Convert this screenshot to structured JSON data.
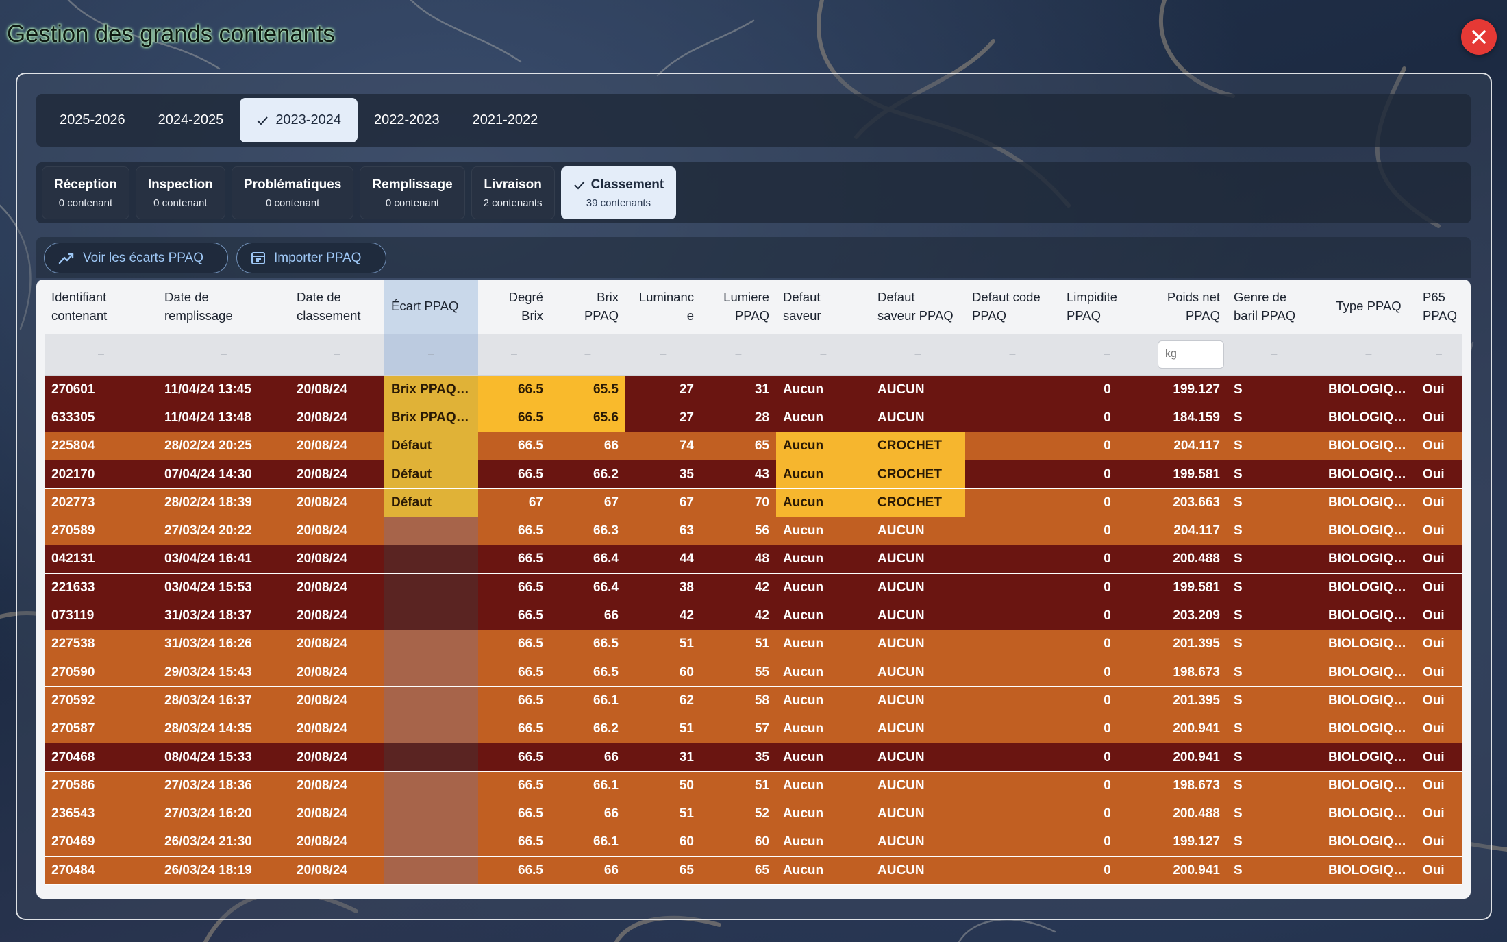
{
  "app": {
    "title": "Gestion des grands contenants"
  },
  "years": [
    {
      "label": "2025-2026",
      "active": false
    },
    {
      "label": "2024-2025",
      "active": false
    },
    {
      "label": "2023-2024",
      "active": true
    },
    {
      "label": "2022-2023",
      "active": false
    },
    {
      "label": "2021-2022",
      "active": false
    }
  ],
  "stages": [
    {
      "label": "Réception",
      "count": "0 contenant",
      "active": false
    },
    {
      "label": "Inspection",
      "count": "0 contenant",
      "active": false
    },
    {
      "label": "Problématiques",
      "count": "0 contenant",
      "active": false
    },
    {
      "label": "Remplissage",
      "count": "0 contenant",
      "active": false
    },
    {
      "label": "Livraison",
      "count": "2 contenants",
      "active": false
    },
    {
      "label": "Classement",
      "count": "39 contenants",
      "active": true
    }
  ],
  "actions": {
    "voir_ecarts": "Voir les écarts PPAQ",
    "importer": "Importer PPAQ"
  },
  "table": {
    "headers": {
      "id": [
        "Identifiant",
        "contenant"
      ],
      "date_remplissage": [
        "Date de",
        "remplissage"
      ],
      "date_classement": [
        "Date de",
        "classement"
      ],
      "ecart": [
        "Écart PPAQ"
      ],
      "degre_brix": [
        "Degré",
        "Brix"
      ],
      "brix_ppaq": [
        "Brix",
        "PPAQ"
      ],
      "luminance": [
        "Luminanc",
        "e"
      ],
      "lumiere_ppaq": [
        "Lumiere",
        "PPAQ"
      ],
      "defaut_saveur": [
        "Defaut",
        "saveur"
      ],
      "defaut_saveur_ppaq": [
        "Defaut",
        "saveur PPAQ"
      ],
      "defaut_code_ppaq": [
        "Defaut code",
        "PPAQ"
      ],
      "limpidite_ppaq": [
        "Limpidite",
        "PPAQ"
      ],
      "poids_net_ppaq": [
        "Poids net",
        "PPAQ"
      ],
      "genre_baril": [
        "Genre de",
        "baril PPAQ"
      ],
      "type_ppaq": [
        "Type PPAQ"
      ],
      "p65_ppaq": [
        "P65",
        "PPAQ"
      ]
    },
    "filter_dash": "–",
    "kg_placeholder": "kg",
    "colors": {
      "orange": "#c15f22",
      "dark_red": "#6a1511",
      "yellow": "#f9ba2c"
    },
    "rows": [
      {
        "tone": "dark",
        "id": "270601",
        "date_remplissage": "11/04/24 13:45",
        "date_classement": "20/08/24",
        "ecart": "Brix PPAQ différent",
        "ecart_flag": true,
        "degre_brix": "66.5",
        "brix_ppaq": "65.5",
        "hl_brix": true,
        "luminance": "27",
        "lumiere_ppaq": "31",
        "defaut_saveur": "Aucun",
        "defaut_saveur_ppaq": "AUCUN",
        "hl_saveur": false,
        "defaut_code_ppaq": "",
        "limpidite_ppaq": "0",
        "poids_net_ppaq": "199.127",
        "genre_baril": "S",
        "type_ppaq": "BIOLOGIQUE",
        "p65_ppaq": "Oui"
      },
      {
        "tone": "dark",
        "id": "633305",
        "date_remplissage": "11/04/24 13:48",
        "date_classement": "20/08/24",
        "ecart": "Brix PPAQ différent",
        "ecart_flag": true,
        "degre_brix": "66.5",
        "brix_ppaq": "65.6",
        "hl_brix": true,
        "luminance": "27",
        "lumiere_ppaq": "28",
        "defaut_saveur": "Aucun",
        "defaut_saveur_ppaq": "AUCUN",
        "hl_saveur": false,
        "defaut_code_ppaq": "",
        "limpidite_ppaq": "0",
        "poids_net_ppaq": "184.159",
        "genre_baril": "S",
        "type_ppaq": "BIOLOGIQUE",
        "p65_ppaq": "Oui"
      },
      {
        "tone": "orange",
        "id": "225804",
        "date_remplissage": "28/02/24 20:25",
        "date_classement": "20/08/24",
        "ecart": "Défaut",
        "ecart_flag": true,
        "degre_brix": "66.5",
        "brix_ppaq": "66",
        "hl_brix": false,
        "luminance": "74",
        "lumiere_ppaq": "65",
        "defaut_saveur": "Aucun",
        "defaut_saveur_ppaq": "CROCHET",
        "hl_saveur": true,
        "defaut_code_ppaq": "",
        "limpidite_ppaq": "0",
        "poids_net_ppaq": "204.117",
        "genre_baril": "S",
        "type_ppaq": "BIOLOGIQUE",
        "p65_ppaq": "Oui"
      },
      {
        "tone": "dark",
        "id": "202170",
        "date_remplissage": "07/04/24 14:30",
        "date_classement": "20/08/24",
        "ecart": "Défaut",
        "ecart_flag": true,
        "degre_brix": "66.5",
        "brix_ppaq": "66.2",
        "hl_brix": false,
        "luminance": "35",
        "lumiere_ppaq": "43",
        "defaut_saveur": "Aucun",
        "defaut_saveur_ppaq": "CROCHET",
        "hl_saveur": true,
        "defaut_code_ppaq": "",
        "limpidite_ppaq": "0",
        "poids_net_ppaq": "199.581",
        "genre_baril": "S",
        "type_ppaq": "BIOLOGIQUE",
        "p65_ppaq": "Oui"
      },
      {
        "tone": "orange",
        "id": "202773",
        "date_remplissage": "28/02/24 18:39",
        "date_classement": "20/08/24",
        "ecart": "Défaut",
        "ecart_flag": true,
        "degre_brix": "67",
        "brix_ppaq": "67",
        "hl_brix": false,
        "luminance": "67",
        "lumiere_ppaq": "70",
        "defaut_saveur": "Aucun",
        "defaut_saveur_ppaq": "CROCHET",
        "hl_saveur": true,
        "defaut_code_ppaq": "",
        "limpidite_ppaq": "0",
        "poids_net_ppaq": "203.663",
        "genre_baril": "S",
        "type_ppaq": "BIOLOGIQUE",
        "p65_ppaq": "Oui"
      },
      {
        "tone": "orange",
        "id": "270589",
        "date_remplissage": "27/03/24 20:22",
        "date_classement": "20/08/24",
        "ecart": "",
        "ecart_flag": false,
        "degre_brix": "66.5",
        "brix_ppaq": "66.3",
        "hl_brix": false,
        "luminance": "63",
        "lumiere_ppaq": "56",
        "defaut_saveur": "Aucun",
        "defaut_saveur_ppaq": "AUCUN",
        "hl_saveur": false,
        "defaut_code_ppaq": "",
        "limpidite_ppaq": "0",
        "poids_net_ppaq": "204.117",
        "genre_baril": "S",
        "type_ppaq": "BIOLOGIQUE",
        "p65_ppaq": "Oui"
      },
      {
        "tone": "dark",
        "id": "042131",
        "date_remplissage": "03/04/24 16:41",
        "date_classement": "20/08/24",
        "ecart": "",
        "ecart_flag": false,
        "degre_brix": "66.5",
        "brix_ppaq": "66.4",
        "hl_brix": false,
        "luminance": "44",
        "lumiere_ppaq": "48",
        "defaut_saveur": "Aucun",
        "defaut_saveur_ppaq": "AUCUN",
        "hl_saveur": false,
        "defaut_code_ppaq": "",
        "limpidite_ppaq": "0",
        "poids_net_ppaq": "200.488",
        "genre_baril": "S",
        "type_ppaq": "BIOLOGIQUE",
        "p65_ppaq": "Oui"
      },
      {
        "tone": "dark",
        "id": "221633",
        "date_remplissage": "03/04/24 15:53",
        "date_classement": "20/08/24",
        "ecart": "",
        "ecart_flag": false,
        "degre_brix": "66.5",
        "brix_ppaq": "66.4",
        "hl_brix": false,
        "luminance": "38",
        "lumiere_ppaq": "42",
        "defaut_saveur": "Aucun",
        "defaut_saveur_ppaq": "AUCUN",
        "hl_saveur": false,
        "defaut_code_ppaq": "",
        "limpidite_ppaq": "0",
        "poids_net_ppaq": "199.581",
        "genre_baril": "S",
        "type_ppaq": "BIOLOGIQUE",
        "p65_ppaq": "Oui"
      },
      {
        "tone": "dark",
        "id": "073119",
        "date_remplissage": "31/03/24 18:37",
        "date_classement": "20/08/24",
        "ecart": "",
        "ecart_flag": false,
        "degre_brix": "66.5",
        "brix_ppaq": "66",
        "hl_brix": false,
        "luminance": "42",
        "lumiere_ppaq": "42",
        "defaut_saveur": "Aucun",
        "defaut_saveur_ppaq": "AUCUN",
        "hl_saveur": false,
        "defaut_code_ppaq": "",
        "limpidite_ppaq": "0",
        "poids_net_ppaq": "203.209",
        "genre_baril": "S",
        "type_ppaq": "BIOLOGIQUE",
        "p65_ppaq": "Oui"
      },
      {
        "tone": "orange",
        "id": "227538",
        "date_remplissage": "31/03/24 16:26",
        "date_classement": "20/08/24",
        "ecart": "",
        "ecart_flag": false,
        "degre_brix": "66.5",
        "brix_ppaq": "66.5",
        "hl_brix": false,
        "luminance": "51",
        "lumiere_ppaq": "51",
        "defaut_saveur": "Aucun",
        "defaut_saveur_ppaq": "AUCUN",
        "hl_saveur": false,
        "defaut_code_ppaq": "",
        "limpidite_ppaq": "0",
        "poids_net_ppaq": "201.395",
        "genre_baril": "S",
        "type_ppaq": "BIOLOGIQUE",
        "p65_ppaq": "Oui"
      },
      {
        "tone": "orange",
        "id": "270590",
        "date_remplissage": "29/03/24 15:43",
        "date_classement": "20/08/24",
        "ecart": "",
        "ecart_flag": false,
        "degre_brix": "66.5",
        "brix_ppaq": "66.5",
        "hl_brix": false,
        "luminance": "60",
        "lumiere_ppaq": "55",
        "defaut_saveur": "Aucun",
        "defaut_saveur_ppaq": "AUCUN",
        "hl_saveur": false,
        "defaut_code_ppaq": "",
        "limpidite_ppaq": "0",
        "poids_net_ppaq": "198.673",
        "genre_baril": "S",
        "type_ppaq": "BIOLOGIQUE",
        "p65_ppaq": "Oui"
      },
      {
        "tone": "orange",
        "id": "270592",
        "date_remplissage": "28/03/24 16:37",
        "date_classement": "20/08/24",
        "ecart": "",
        "ecart_flag": false,
        "degre_brix": "66.5",
        "brix_ppaq": "66.1",
        "hl_brix": false,
        "luminance": "62",
        "lumiere_ppaq": "58",
        "defaut_saveur": "Aucun",
        "defaut_saveur_ppaq": "AUCUN",
        "hl_saveur": false,
        "defaut_code_ppaq": "",
        "limpidite_ppaq": "0",
        "poids_net_ppaq": "201.395",
        "genre_baril": "S",
        "type_ppaq": "BIOLOGIQUE",
        "p65_ppaq": "Oui"
      },
      {
        "tone": "orange",
        "id": "270587",
        "date_remplissage": "28/03/24 14:35",
        "date_classement": "20/08/24",
        "ecart": "",
        "ecart_flag": false,
        "degre_brix": "66.5",
        "brix_ppaq": "66.2",
        "hl_brix": false,
        "luminance": "51",
        "lumiere_ppaq": "57",
        "defaut_saveur": "Aucun",
        "defaut_saveur_ppaq": "AUCUN",
        "hl_saveur": false,
        "defaut_code_ppaq": "",
        "limpidite_ppaq": "0",
        "poids_net_ppaq": "200.941",
        "genre_baril": "S",
        "type_ppaq": "BIOLOGIQUE",
        "p65_ppaq": "Oui"
      },
      {
        "tone": "dark",
        "id": "270468",
        "date_remplissage": "08/04/24 15:33",
        "date_classement": "20/08/24",
        "ecart": "",
        "ecart_flag": false,
        "degre_brix": "66.5",
        "brix_ppaq": "66",
        "hl_brix": false,
        "luminance": "31",
        "lumiere_ppaq": "35",
        "defaut_saveur": "Aucun",
        "defaut_saveur_ppaq": "AUCUN",
        "hl_saveur": false,
        "defaut_code_ppaq": "",
        "limpidite_ppaq": "0",
        "poids_net_ppaq": "200.941",
        "genre_baril": "S",
        "type_ppaq": "BIOLOGIQUE",
        "p65_ppaq": "Oui"
      },
      {
        "tone": "orange",
        "id": "270586",
        "date_remplissage": "27/03/24 18:36",
        "date_classement": "20/08/24",
        "ecart": "",
        "ecart_flag": false,
        "degre_brix": "66.5",
        "brix_ppaq": "66.1",
        "hl_brix": false,
        "luminance": "50",
        "lumiere_ppaq": "51",
        "defaut_saveur": "Aucun",
        "defaut_saveur_ppaq": "AUCUN",
        "hl_saveur": false,
        "defaut_code_ppaq": "",
        "limpidite_ppaq": "0",
        "poids_net_ppaq": "198.673",
        "genre_baril": "S",
        "type_ppaq": "BIOLOGIQUE",
        "p65_ppaq": "Oui"
      },
      {
        "tone": "orange",
        "id": "236543",
        "date_remplissage": "27/03/24 16:20",
        "date_classement": "20/08/24",
        "ecart": "",
        "ecart_flag": false,
        "degre_brix": "66.5",
        "brix_ppaq": "66",
        "hl_brix": false,
        "luminance": "51",
        "lumiere_ppaq": "52",
        "defaut_saveur": "Aucun",
        "defaut_saveur_ppaq": "AUCUN",
        "hl_saveur": false,
        "defaut_code_ppaq": "",
        "limpidite_ppaq": "0",
        "poids_net_ppaq": "200.488",
        "genre_baril": "S",
        "type_ppaq": "BIOLOGIQUE",
        "p65_ppaq": "Oui"
      },
      {
        "tone": "orange",
        "id": "270469",
        "date_remplissage": "26/03/24 21:30",
        "date_classement": "20/08/24",
        "ecart": "",
        "ecart_flag": false,
        "degre_brix": "66.5",
        "brix_ppaq": "66.1",
        "hl_brix": false,
        "luminance": "60",
        "lumiere_ppaq": "60",
        "defaut_saveur": "Aucun",
        "defaut_saveur_ppaq": "AUCUN",
        "hl_saveur": false,
        "defaut_code_ppaq": "",
        "limpidite_ppaq": "0",
        "poids_net_ppaq": "199.127",
        "genre_baril": "S",
        "type_ppaq": "BIOLOGIQUE",
        "p65_ppaq": "Oui"
      },
      {
        "tone": "orange",
        "id": "270484",
        "date_remplissage": "26/03/24 18:19",
        "date_classement": "20/08/24",
        "ecart": "",
        "ecart_flag": false,
        "degre_brix": "66.5",
        "brix_ppaq": "66",
        "hl_brix": false,
        "luminance": "65",
        "lumiere_ppaq": "65",
        "defaut_saveur": "Aucun",
        "defaut_saveur_ppaq": "AUCUN",
        "hl_saveur": false,
        "defaut_code_ppaq": "",
        "limpidite_ppaq": "0",
        "poids_net_ppaq": "200.941",
        "genre_baril": "S",
        "type_ppaq": "BIOLOGIQUE",
        "p65_ppaq": "Oui"
      }
    ]
  }
}
